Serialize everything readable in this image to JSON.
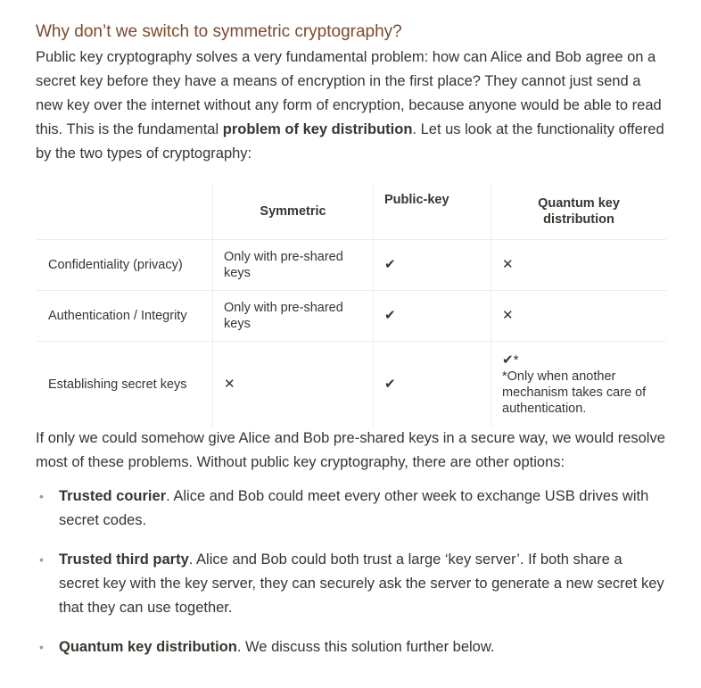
{
  "heading": "Why don’t we switch to symmetric cryptography?",
  "intro": {
    "text_before": "Public key cryptography solves a very fundamental problem: how can Alice and Bob agree on a secret key before they have a means of encryption in the first place? They cannot just send a new key over the internet without any form of encryption, because anyone would be able to read this. This is the fundamental ",
    "bold": "problem of key distribution",
    "text_after": ". Let us look at the functionality offered by the two types of cryptography:"
  },
  "table": {
    "headers": [
      "",
      "Symmetric",
      "Public-key",
      "Quantum key distribution"
    ],
    "rows": [
      {
        "label": "Confidentiality (privacy)",
        "symmetric": "Only with pre-shared keys",
        "public_key": "✔",
        "qkd": "✕"
      },
      {
        "label": "Authentication / Integrity",
        "symmetric": "Only with pre-shared keys",
        "public_key": "✔",
        "qkd": "✕"
      },
      {
        "label": "Establishing secret keys",
        "symmetric": "✕",
        "public_key": "✔",
        "qkd_mark": "✔*",
        "qkd_note": "*Only when another mechanism takes care of authentication."
      }
    ]
  },
  "para2": "If only we could somehow give Alice and Bob pre-shared keys in a secure way, we would resolve most of these problems. Without public key cryptography, there are other options:",
  "bullets": [
    {
      "bold": "Trusted courier",
      "text": ". Alice and Bob could meet every other week to exchange USB drives with secret codes."
    },
    {
      "bold": "Trusted third party",
      "text": ". Alice and Bob could both trust a large ‘key server’. If both share a secret key with the key server, they can securely ask the server to generate a new secret key that they can use together."
    },
    {
      "bold": "Quantum key distribution",
      "text": ". We discuss this solution further below."
    }
  ]
}
